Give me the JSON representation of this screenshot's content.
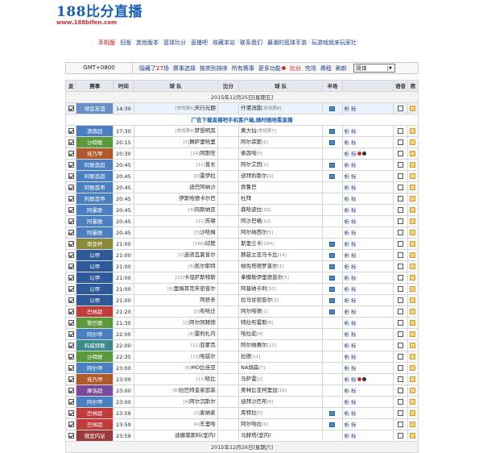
{
  "logo": {
    "title": "188比分直播",
    "url": "www.188bifen.com"
  },
  "nav": [
    {
      "label": "手机版",
      "red": true
    },
    {
      "label": "旧版"
    },
    {
      "label": "其他版本"
    },
    {
      "label": "篮球比分"
    },
    {
      "label": "直播吧"
    },
    {
      "label": "收藏本站"
    },
    {
      "label": "联系我们"
    },
    {
      "label": "最潮的篮球手游"
    },
    {
      "label": "玩游戏就来玩家社"
    }
  ],
  "toolbar": {
    "gmt": "GMT+0800",
    "hidden_prefix": "隐藏了",
    "hidden_count": "27",
    "hidden_suffix": "场",
    "filter": "赛事选择",
    "sort": "按类别排序",
    "all": "所有赛事",
    "more": "更多功能",
    "score": "比分",
    "finished": "完场",
    "schedule": "赛程",
    "refresh": "刷新",
    "lang": "简体"
  },
  "headers": {
    "show": "显",
    "league": "赛事",
    "time": "时间",
    "home": "球 队",
    "score": "比分",
    "away": "球 队",
    "half": "半场",
    "data": "",
    "rec": "语音",
    "fav": "筛"
  },
  "date1": "2015年12月25日[星期五]",
  "ad": "广告下载直播吧手机客户端,随时随地看直播",
  "date2": "2015年12月26日[星期六]",
  "colors": {
    "blue": "#4a7fc1",
    "green": "#5a9a3a",
    "brown": "#8a5a2b",
    "red": "#c23b3b",
    "purple": "#7a4a9a",
    "olive": "#8a8a3a",
    "teal": "#3a8a8a",
    "navy": "#2e5a9a",
    "maroon": "#9a3a3a",
    "slate": "#5a6a8a"
  },
  "matches": [
    {
      "league": "球会友谊",
      "lc": "#6a8fc8",
      "time": "14:30",
      "hrank": "[常规赛5]",
      "home": "天行元期",
      "score": "",
      "away": "仟港流鼎",
      "arank": "[常规赛8]",
      "tv": true,
      "hl": true
    },
    {
      "league": "澳南超",
      "lc": "#4a7fc1",
      "time": "17:30",
      "hrank": "[常规赛4]",
      "home": "梦想明其",
      "score": "",
      "away": "黄大仙",
      "arank": "[常规赛7]",
      "tv": true,
      "hl": false
    },
    {
      "league": "沙特联",
      "lc": "#5a9a3a",
      "time": "20:15",
      "hrank": "[5]",
      "home": "舞萨里哈里",
      "score": "",
      "away": "阿尔菲斯",
      "arank": "[6]",
      "tv": true,
      "hl": false
    },
    {
      "league": "埃乃甲",
      "lc": "#b05a2b",
      "time": "20:30",
      "hrank": "[14]",
      "home": "阿斯旺",
      "score": "",
      "away": "索酋哈",
      "arank": "[5]",
      "tv": false,
      "hl": false,
      "zs": true
    },
    {
      "league": "阿联酋超",
      "lc": "#4a7fc1",
      "time": "20:45",
      "hrank": "[11]",
      "home": "普长",
      "score": "",
      "away": "阿尔艾因",
      "arank": "[1]",
      "tv": true,
      "hl": false
    },
    {
      "league": "阿联酋超",
      "lc": "#4a7fc1",
      "time": "20:45",
      "hrank": "[6]",
      "home": "雷伊拉",
      "score": "",
      "away": "迪拜豹斯尔",
      "arank": "[3]",
      "tv": true,
      "hl": false
    },
    {
      "league": "阿联酋甲",
      "lc": "#4a7fc1",
      "time": "20:45",
      "hrank": "",
      "home": "迪巴阿纳沙",
      "score": "",
      "away": "贾鲁巴",
      "arank": "",
      "tv": false,
      "hl": false
    },
    {
      "league": "阿联酋甲",
      "lc": "#4a7fc1",
      "time": "20:45",
      "hrank": "",
      "home": "伊斯哈德卡尔巴",
      "score": "",
      "away": "杜拜",
      "arank": "",
      "tv": false,
      "hl": false
    },
    {
      "league": "阿曼联",
      "lc": "#4a7fc1",
      "time": "20:45",
      "hrank": "[9]",
      "home": "玛斯纳亚",
      "score": "",
      "away": "鼎哈波拉",
      "arank": "[10]",
      "tv": false,
      "hl": false
    },
    {
      "league": "阿曼联",
      "lc": "#4a7fc1",
      "time": "20:45",
      "hrank": "[11]",
      "home": "苏碨",
      "score": "",
      "away": "阿沙巴格",
      "arank": "[12]",
      "tv": false,
      "hl": false
    },
    {
      "league": "阿曼联",
      "lc": "#4a7fc1",
      "time": "20:45",
      "hrank": "[3]",
      "home": "沙哈姆",
      "score": "",
      "away": "阿尔纳西尔",
      "arank": "[5]",
      "tv": false,
      "hl": false
    },
    {
      "league": "南亚杯",
      "lc": "#8a8a3a",
      "time": "21:00",
      "hrank": "[166]",
      "home": "印度",
      "score": "",
      "away": "斯里兰卡",
      "arank": "[194]",
      "tv": true,
      "hl": false
    },
    {
      "league": "以甲",
      "lc": "#2e5a9a",
      "time": "21:00",
      "hrank": "[1]",
      "home": "迪咨瓦夏普尔",
      "score": "",
      "away": "赫兹立亚马卡比",
      "arank": "[14]",
      "tv": true,
      "hl": false
    },
    {
      "league": "以甲",
      "lc": "#2e5a9a",
      "time": "21:00",
      "hrank": "[6]",
      "home": "凯尔耶特",
      "score": "",
      "away": "柏佐塔德罗普尔",
      "arank": "[1]",
      "tv": true,
      "hl": false
    },
    {
      "league": "以甲",
      "lc": "#2e5a9a",
      "time": "21:00",
      "hrank": "[13]",
      "home": "卡坦萨斯特斯",
      "score": "",
      "away": "拿撒勒伊里德普尔",
      "arank": "[5]",
      "tv": true,
      "hl": false
    },
    {
      "league": "以甲",
      "lc": "#2e5a9a",
      "time": "21:00",
      "hrank": "[6]",
      "home": "里姆耳克朱密普尔",
      "score": "",
      "away": "阿基纳卡利",
      "arank": "[10]",
      "tv": true,
      "hl": false
    },
    {
      "league": "以甲",
      "lc": "#2e5a9a",
      "time": "21:00",
      "hrank": "",
      "home": "阿舒多",
      "score": "",
      "away": "拉马甘密普尔",
      "arank": "[3]",
      "tv": true,
      "hl": false
    },
    {
      "league": "巴林超",
      "lc": "#c23b3b",
      "time": "21:20",
      "hrank": "[3]",
      "home": "布哈迁",
      "score": "",
      "away": "阿尔哈德",
      "arank": "[1]",
      "tv": true,
      "hl": false
    },
    {
      "league": "黎巴联",
      "lc": "#5a9a3a",
      "time": "21:30",
      "hrank": "[2]",
      "home": "阿尔阿赫德",
      "score": "",
      "away": "特拉布雷斯",
      "arank": "[8]",
      "tv": false,
      "hl": false
    },
    {
      "league": "阿尔甲",
      "lc": "#4a7fc1",
      "time": "22:00",
      "hrank": "[8]",
      "home": "雷利扎内",
      "score": "",
      "away": "哈拉驼",
      "arank": "[4]",
      "tv": false,
      "hl": false
    },
    {
      "league": "科威特联",
      "lc": "#3a8a8a",
      "time": "22:00",
      "hrank": "[11]",
      "home": "亚蒙克",
      "score": "",
      "away": "阿尔纳赛尔",
      "arank": "[13]",
      "tv": false,
      "hl": false
    },
    {
      "league": "沙特联",
      "lc": "#5a9a3a",
      "time": "22:35",
      "hrank": "[13]",
      "home": "哈兹尔",
      "score": "",
      "away": "拉德",
      "arank": "[11]",
      "tv": false,
      "hl": false
    },
    {
      "league": "阿尔甲",
      "lc": "#4a7fc1",
      "time": "23:00",
      "hrank": "[6]",
      "home": "MO比佳亚",
      "score": "",
      "away": "NA胡森",
      "arank": "[7]",
      "tv": false,
      "hl": false
    },
    {
      "league": "埃乃甲",
      "lc": "#b05a2b",
      "time": "23:00",
      "hrank": "[12]",
      "home": "哈比",
      "score": "",
      "away": "马萨雷",
      "arank": "[2]",
      "tv": false,
      "hl": false,
      "zs": true
    },
    {
      "league": "摩洛超",
      "lc": "#7a4a9a",
      "time": "23:00",
      "hrank": "[8]",
      "home": "拉巴特皇家武装",
      "score": "",
      "away": "奥林比亚柯里加",
      "arank": "[16]",
      "tv": false,
      "hl": false
    },
    {
      "league": "阿尔甲",
      "lc": "#4a7fc1",
      "time": "23:00",
      "hrank": "[4]",
      "home": "阿尔沉斯尔",
      "score": "",
      "away": "迪拜沙巴布",
      "arank": "[6]",
      "tv": false,
      "hl": false
    },
    {
      "league": "巴林超",
      "lc": "#c23b3b",
      "time": "23:59",
      "hrank": "[2]",
      "home": "麦纳麦",
      "score": "",
      "away": "库特拉",
      "arank": "[5]",
      "tv": true,
      "hl": false
    },
    {
      "league": "巴林超",
      "lc": "#c23b3b",
      "time": "23:59",
      "hrank": "[4]",
      "home": "东里哈",
      "score": "",
      "away": "阿尔哈拉",
      "arank": "[6]",
      "tv": true,
      "hl": false
    },
    {
      "league": "俄室内足",
      "lc": "#9a3a3a",
      "time": "23:59",
      "hrank": "",
      "home": "迪娜莫斯科(室内)",
      "score": "",
      "away": "马赫塔(室内)",
      "arank": "",
      "tv": false,
      "hl": false
    }
  ],
  "analysis": "析",
  "odds": "标"
}
